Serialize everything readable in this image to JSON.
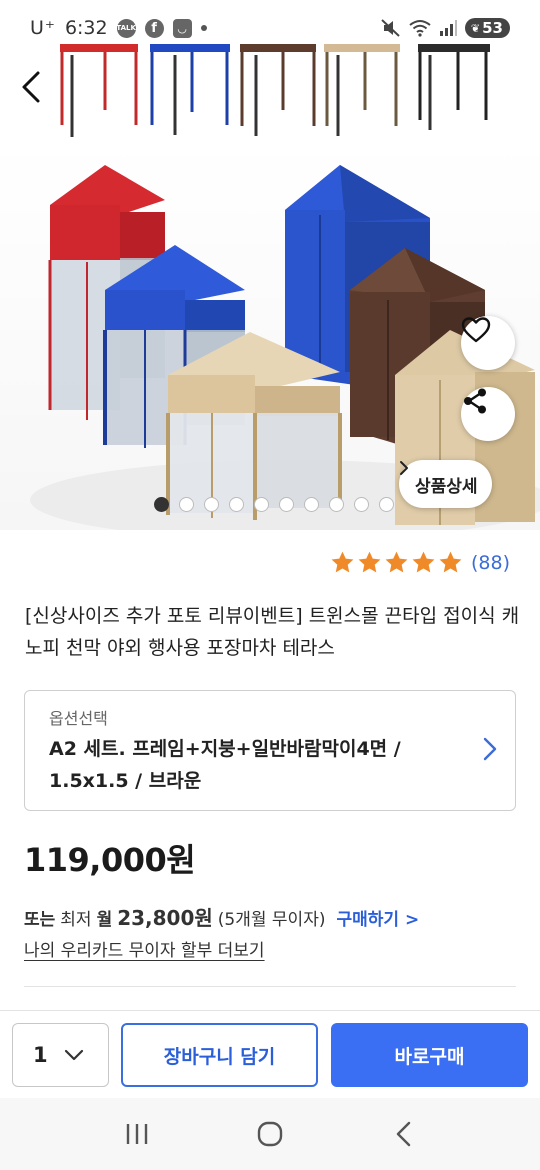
{
  "status_bar": {
    "carrier": "U⁺",
    "time": "6:32",
    "notif_icons": [
      "talk-icon",
      "facebook-icon",
      "smile-box-icon"
    ],
    "battery": "53"
  },
  "gallery": {
    "detail_button_label": "상품상세",
    "page_count": 10,
    "active_page": 1,
    "tent_colors": [
      "#d9262d",
      "#1f4fc0",
      "#6a4434",
      "#d7c09b",
      "#3a3a3a"
    ]
  },
  "rating": {
    "stars": 5,
    "count_text": "(88)",
    "star_color": "#f08a28"
  },
  "product": {
    "title": "[신상사이즈 추가 포토 리뷰이벤트] 트윈스몰 끈타입 접이식 캐노피 천막 야외 행사용 포장마차 테라스"
  },
  "option": {
    "label": "옵션선택",
    "value": "A2 세트. 프레임+지붕+일반바람막이4면 / 1.5x1.5 / 브라운"
  },
  "price": {
    "amount": "119,000원",
    "installment_prefix": "또는",
    "installment_min": "최저",
    "installment_monthly": "월",
    "installment_amount": "23,800원",
    "installment_terms": "(5개월 무이자)",
    "installment_link": "구매하기 >",
    "card_link": "나의 우리카드 무이자 할부 더보기"
  },
  "purchase_bar": {
    "quantity": "1",
    "cart_label": "장바구니 담기",
    "buy_label": "바로구매"
  },
  "colors": {
    "accent": "#3a6ef3",
    "link": "#2b5fd9"
  }
}
